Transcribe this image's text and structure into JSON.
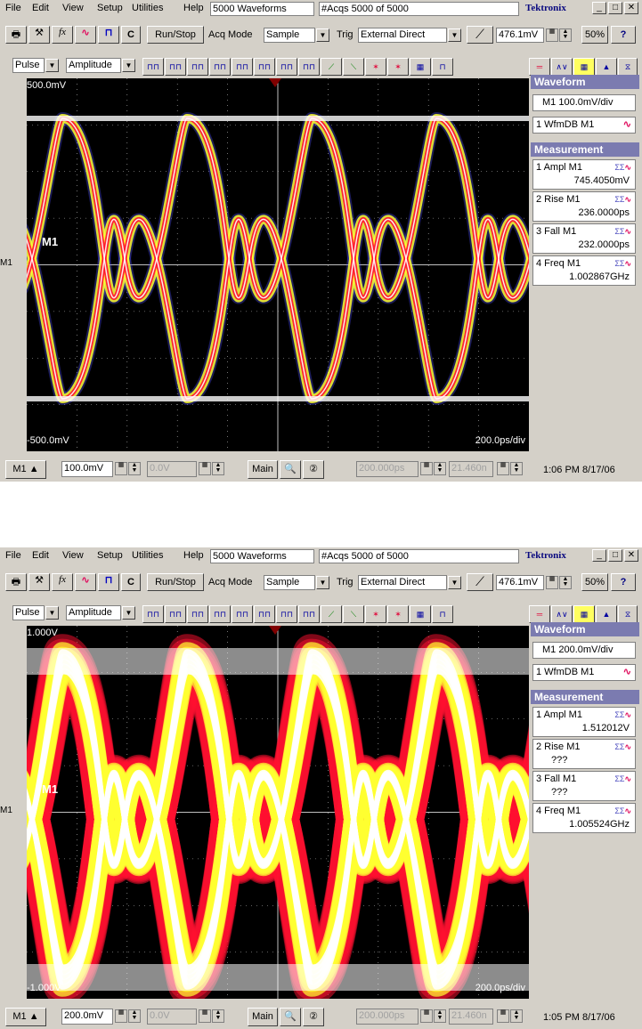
{
  "menu": [
    "File",
    "Edit",
    "View",
    "Setup",
    "Utilities",
    "Help"
  ],
  "brand": "Tektronix",
  "window_buttons": [
    "_",
    "□",
    "✕"
  ],
  "toolbar": {
    "run_stop": "Run/Stop",
    "acq_mode_label": "Acq Mode",
    "acq_mode_value": "Sample",
    "trig_label": "Trig",
    "trig_value": "External Direct",
    "trig_level": "476.1mV",
    "zoom_percent": "50%",
    "help": "?",
    "c_label": "C"
  },
  "measure_toolbar": {
    "category": "Pulse",
    "measurement": "Amplitude"
  },
  "scopes": [
    {
      "waveform_count": "5000 Waveforms",
      "acqs": "#Acqs  5000 of 5000",
      "y_top": "500.0mV",
      "y_bottom": "-500.0mV",
      "time_div": "200.0ps/div",
      "channel_label": "M1",
      "channel_marker": "M1",
      "side": {
        "waveform_header": "Waveform",
        "scale": "M1 100.0mV/div",
        "wfmdb": "1 WfmDB M1",
        "measurement_header": "Measurement",
        "measurements": [
          {
            "line1": "1 Ampl   M1",
            "value": "745.4050mV"
          },
          {
            "line1": "2 Rise   M1",
            "value": "236.0000ps"
          },
          {
            "line1": "3 Fall    M1",
            "value": "232.0000ps"
          },
          {
            "line1": "4 Freq   M1",
            "value": "1.002867GHz"
          }
        ]
      },
      "status": {
        "channel": "M1",
        "scale": "100.0mV",
        "offset": "0.0V",
        "main": "Main",
        "position": "200.000ps",
        "delay": "21.460n",
        "clock": "1:06 PM 8/17/06"
      }
    },
    {
      "waveform_count": "5000 Waveforms",
      "acqs": "#Acqs  5000 of 5000",
      "y_top": "1.000V",
      "y_bottom": "-1.000V",
      "time_div": "200.0ps/div",
      "channel_label": "M1",
      "channel_marker": "M1",
      "side": {
        "waveform_header": "Waveform",
        "scale": "M1 200.0mV/div",
        "wfmdb": "1 WfmDB M1",
        "measurement_header": "Measurement",
        "measurements": [
          {
            "line1": "1 Ampl   M1",
            "value": "1.512012V"
          },
          {
            "line1": "2 Rise   M1",
            "value": "???"
          },
          {
            "line1": "3 Fall    M1",
            "value": "???"
          },
          {
            "line1": "4 Freq   M1",
            "value": "1.005524GHz"
          }
        ]
      },
      "status": {
        "channel": "M1",
        "scale": "200.0mV",
        "offset": "0.0V",
        "main": "Main",
        "position": "200.000ps",
        "delay": "21.460n",
        "clock": "1:05 PM 8/17/06"
      }
    }
  ],
  "icons": {
    "print": "printer-icon",
    "tools": "tools-icon",
    "fx": "function-icon",
    "wave": "waveform-icon",
    "measure": "measure-icon",
    "zoom_in": "zoom-in-icon",
    "zoom_out": "zoom-out-icon",
    "trigger_edge": "trigger-edge-icon"
  },
  "colors": {
    "eye_core": "#ff1030",
    "eye_edge": "#ffff30",
    "eye_high": "#ffffff",
    "eye_fringe": "#5050ff",
    "side_header": "#7b7bb0",
    "graticule": "#c0c0c0"
  }
}
